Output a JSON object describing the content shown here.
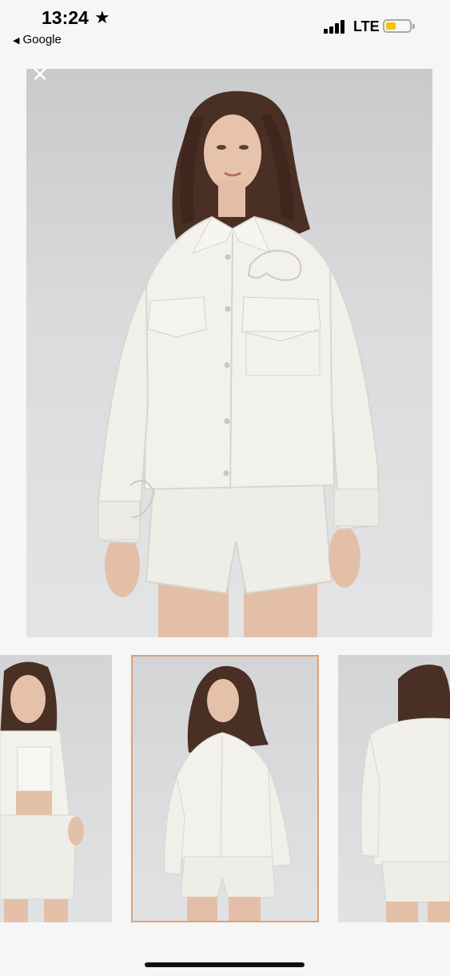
{
  "status_bar": {
    "time": "13:24",
    "star": "★",
    "back_label": "Google",
    "back_arrow": "◀",
    "network": "LTE",
    "battery_level": 0.35,
    "battery_color": "#f2c400"
  },
  "viewer": {
    "close_glyph": "✕",
    "selected_thumbnail": 2
  },
  "thumbnails": [
    {
      "label": "front-open-view"
    },
    {
      "label": "front-closed-view"
    },
    {
      "label": "back-view"
    }
  ],
  "colors": {
    "selection_border": "#d9a27a",
    "garment": "#f3f1ec"
  }
}
